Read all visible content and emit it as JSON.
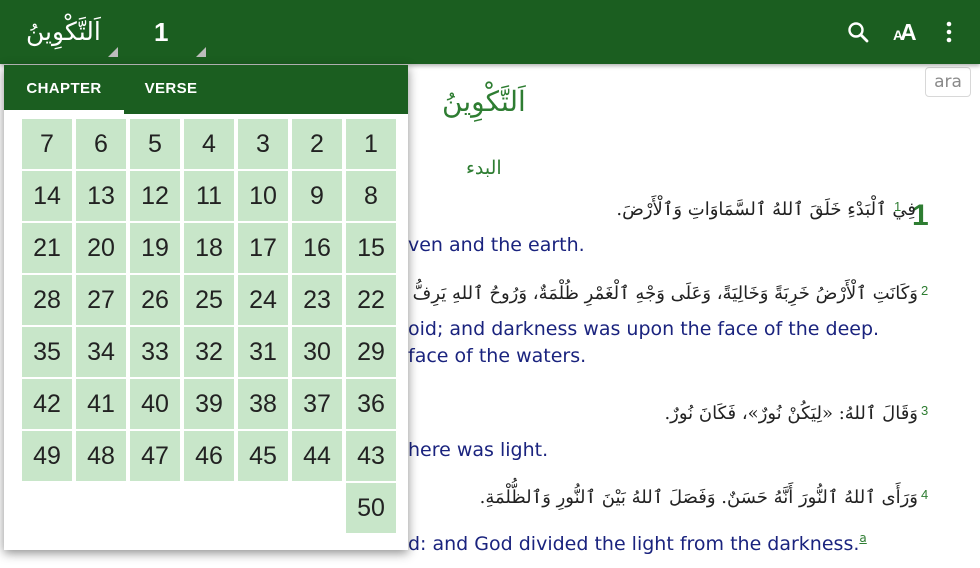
{
  "toolbar": {
    "book": "اَلتَّكْوِينُ",
    "chapter": "1",
    "icons": [
      "search-icon",
      "font-size-icon",
      "more-vert-icon"
    ]
  },
  "popup": {
    "tabs": [
      "CHAPTER",
      "VERSE"
    ],
    "selected_tab": "CHAPTER",
    "numbers": [
      "1",
      "2",
      "3",
      "4",
      "5",
      "6",
      "7",
      "8",
      "9",
      "10",
      "11",
      "12",
      "13",
      "14",
      "15",
      "16",
      "17",
      "18",
      "19",
      "20",
      "21",
      "22",
      "23",
      "24",
      "25",
      "26",
      "27",
      "28",
      "29",
      "30",
      "31",
      "32",
      "33",
      "34",
      "35",
      "36",
      "37",
      "38",
      "39",
      "40",
      "41",
      "42",
      "43",
      "44",
      "45",
      "46",
      "47",
      "48",
      "49",
      "50"
    ]
  },
  "content": {
    "lang_badge": "ara",
    "book_heading": "اَلتَّكْوِينُ",
    "section_heading": "البدء",
    "chapter_number": "1",
    "verses": [
      {
        "num": "1",
        "arabic": "فِي ٱلْبَدْءِ خَلَقَ ٱللهُ ٱلسَّمَاوَاتِ وَٱلْأَرْضَ.",
        "translation": [
          "ven and the earth."
        ]
      },
      {
        "num": "2",
        "arabic": "وَكَانَتِ ٱلْأَرْضُ خَرِبَةً وَخَالِيَةً، وَعَلَى وَجْهِ ٱلْغَمْرِ ظُلْمَةٌ، وَرُوحُ ٱللهِ يَرِفُّ عَ",
        "translation": [
          "oid; and darkness was upon the face of the deep.",
          "face of the waters."
        ]
      },
      {
        "num": "3",
        "arabic": "وَقَالَ ٱللهُ: «لِيَكُنْ نُورٌ»، فَكَانَ نُورٌ.",
        "translation": [
          "here was light."
        ]
      },
      {
        "num": "4",
        "arabic": "وَرَأَى ٱللهُ ٱلنُّورَ أَنَّهُ حَسَنٌ. وَفَصَلَ ٱللهُ بَيْنَ ٱلنُّورِ وَٱلظُّلْمَةِ.",
        "translation": [
          "d: and God divided the light from the darkness."
        ],
        "footnote": "a"
      }
    ]
  },
  "colors": {
    "toolbar": "#1b5e20",
    "accent_green": "#2e7d32",
    "cell_bg": "#c8e6c9",
    "translation_text": "#1a237e"
  }
}
